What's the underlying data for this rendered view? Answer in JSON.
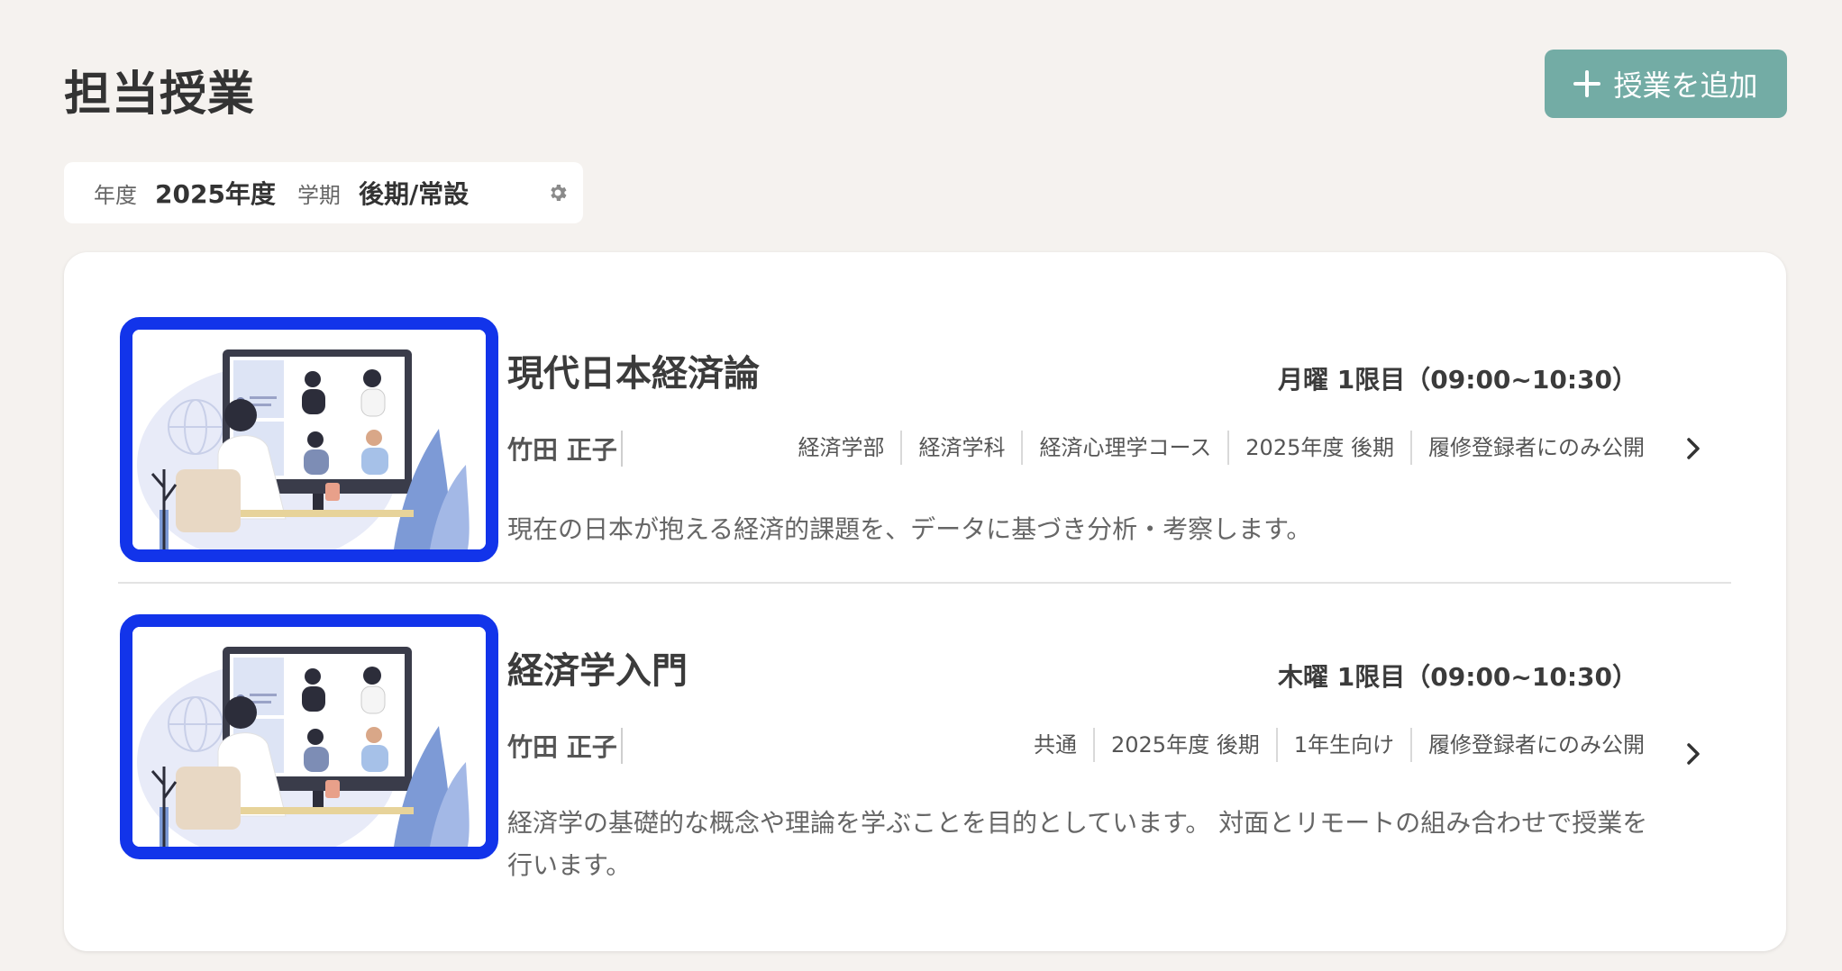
{
  "header": {
    "title": "担当授業",
    "add_button_label": "授業を追加"
  },
  "filter": {
    "year_label": "年度",
    "year_value": "2025年度",
    "term_label": "学期",
    "term_value": "後期/常設"
  },
  "courses": [
    {
      "title": "現代日本経済論",
      "schedule": "月曜 1限目（09:00~10:30）",
      "teacher": "竹田 正子",
      "tags": [
        "経済学部",
        "経済学科",
        "経済心理学コース",
        "2025年度 後期",
        "履修登録者にのみ公開"
      ],
      "description": "現在の日本が抱える経済的課題を、データに基づき分析・考察します。"
    },
    {
      "title": "経済学入門",
      "schedule": "木曜 1限目（09:00~10:30）",
      "teacher": "竹田 正子",
      "tags": [
        "共通",
        "2025年度 後期",
        "1年生向け",
        "履修登録者にのみ公開"
      ],
      "description": "経済学の基礎的な概念や理論を学ぶことを目的としています。 対面とリモートの組み合わせで授業を行います。"
    }
  ],
  "colors": {
    "accent_button": "#73aca5",
    "thumbnail_border": "#1234ea",
    "background": "#f5f2ef"
  },
  "icons": {
    "add": "plus-icon",
    "settings": "gear-icon",
    "open_course": "chevron-right-icon"
  }
}
